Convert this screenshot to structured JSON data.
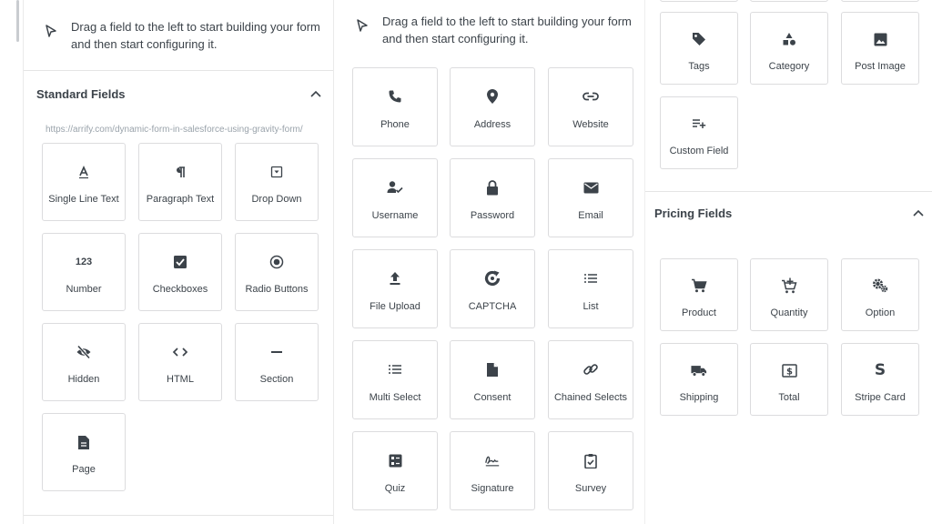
{
  "hint_text": "Drag a field to the left to start building your form and then start configuring it.",
  "standard": {
    "title": "Standard Fields",
    "url": "https://arrify.com/dynamic-form-in-salesforce-using-gravity-form/",
    "items": [
      "Single Line Text",
      "Paragraph Text",
      "Drop Down",
      "Number",
      "Checkboxes",
      "Radio Buttons",
      "Hidden",
      "HTML",
      "Section",
      "Page"
    ]
  },
  "advanced": {
    "items": [
      "Phone",
      "Address",
      "Website",
      "Username",
      "Password",
      "Email",
      "File Upload",
      "CAPTCHA",
      "List",
      "Multi Select",
      "Consent",
      "Chained Selects",
      "Quiz",
      "Signature",
      "Survey"
    ]
  },
  "post": {
    "items": [
      "Tags",
      "Category",
      "Post Image",
      "Custom Field"
    ]
  },
  "pricing": {
    "title": "Pricing Fields",
    "items": [
      "Product",
      "Quantity",
      "Option",
      "Shipping",
      "Total",
      "Stripe Card"
    ]
  },
  "colors": {
    "text": "#3c434a",
    "border": "#dcdcde",
    "url": "#9aa3ab"
  }
}
